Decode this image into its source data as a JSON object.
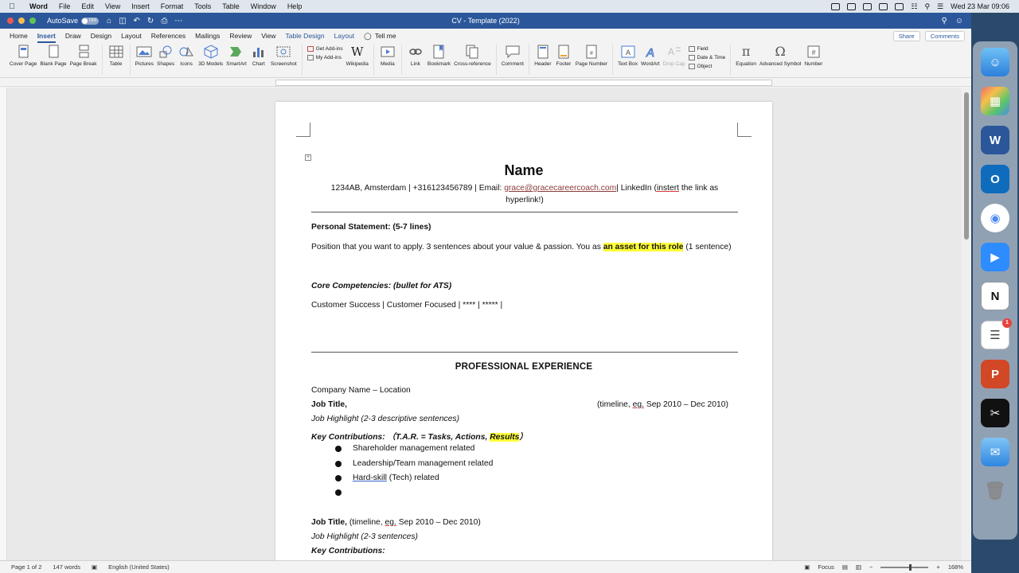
{
  "menubar": {
    "app": "Word",
    "items": [
      "File",
      "Edit",
      "View",
      "Insert",
      "Format",
      "Tools",
      "Table",
      "Window",
      "Help"
    ],
    "clock": "Wed 23 Mar 09:06"
  },
  "titlebar": {
    "autosave_label": "AutoSave",
    "autosave_state": "OFF",
    "document_title": "CV - Template (2022)"
  },
  "tabs": [
    "Home",
    "Insert",
    "Draw",
    "Design",
    "Layout",
    "References",
    "Mailings",
    "Review",
    "View"
  ],
  "contextual_tabs": [
    "Table Design",
    "Layout"
  ],
  "active_tab": "Insert",
  "tell_me": "Tell me",
  "share_label": "Share",
  "comments_label": "Comments",
  "ribbon": {
    "pages": [
      "Cover Page",
      "Blank Page",
      "Page Break"
    ],
    "table": "Table",
    "illustrations": [
      "Pictures",
      "Shapes",
      "Icons",
      "3D Models",
      "SmartArt",
      "Chart",
      "Screenshot"
    ],
    "addins": {
      "get": "Get Add-ins",
      "my": "My Add-ins",
      "wikipedia": "Wikipedia"
    },
    "media": "Media",
    "links": [
      "Link",
      "Bookmark",
      "Cross-reference"
    ],
    "comment": "Comment",
    "header_footer": [
      "Header",
      "Footer",
      "Page Number"
    ],
    "text": [
      "Text Box",
      "WordArt",
      "Drop Cap"
    ],
    "text_small": [
      "Field",
      "Date & Time",
      "Object"
    ],
    "symbols": [
      "Equation",
      "Advanced Symbol",
      "Number"
    ]
  },
  "document": {
    "name": "Name",
    "contact_pre": "1234AB, Amsterdam | +316123456789 | Email: ",
    "email": "grace@gracecareercoach.com",
    "contact_post_a": "| LinkedIn (",
    "contact_instert": "instert",
    "contact_post_b": " the link as hyperlink!)",
    "personal_statement_heading": "Personal Statement: (5-7 lines)",
    "personal_statement_a": "Position that you want to apply. 3 sentences about your value & passion. You as ",
    "personal_statement_hl": "an asset for this role",
    "personal_statement_b": " (1 sentence)",
    "core_heading": "Core Competencies: (bullet for ATS)",
    "core_line": "Customer Success | Customer Focused | **** | ***** |",
    "section_title": "PROFESSIONAL EXPERIENCE",
    "company_line": "Company Name – Location",
    "job_title_1": "Job Title,",
    "timeline_1_a": "(timeline, ",
    "timeline_1_eg": "eg.",
    "timeline_1_b": " Sep 2010 – Dec 2010)",
    "highlight_1": "Job Highlight (2-3 descriptive sentences)",
    "key_contrib_a": "Key Contributions:   （T.A.R. = Tasks, Actions, ",
    "key_contrib_hl": "Results",
    "key_contrib_b": "）",
    "bullets": [
      "Shareholder management related",
      "Leadership/Team management related"
    ],
    "bullet3_a": "Hard-skill",
    "bullet3_b": " (Tech) related",
    "job_title_2": "Job Title,",
    "timeline_2_a": " (timeline, ",
    "timeline_2_eg": "eg.",
    "timeline_2_b": " Sep 2010 – Dec 2010)",
    "highlight_2": "Job Highlight (2-3 sentences)",
    "key_contrib_2": "Key Contributions:"
  },
  "statusbar": {
    "page": "Page 1 of 2",
    "words": "147 words",
    "language": "English (United States)",
    "focus": "Focus",
    "zoom": "168%"
  }
}
